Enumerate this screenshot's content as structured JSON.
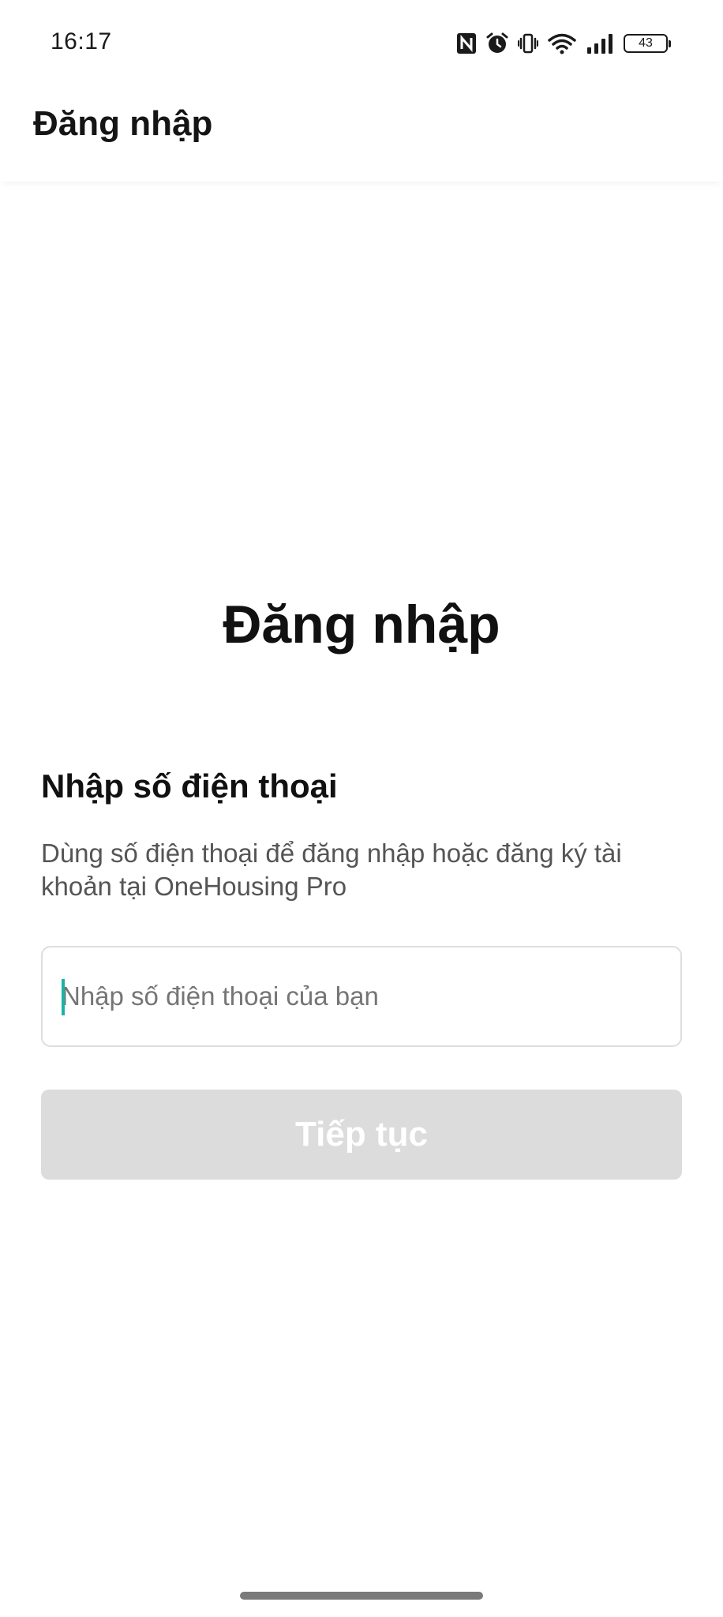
{
  "status_bar": {
    "time": "16:17",
    "battery_level": "43",
    "icons": [
      "nfc-icon",
      "alarm-icon",
      "vibrate-icon",
      "wifi-icon",
      "signal-icon",
      "battery-icon"
    ]
  },
  "app_bar": {
    "title": "Đăng nhập"
  },
  "main": {
    "title": "Đăng nhập",
    "section_heading": "Nhập số điện thoại",
    "description": "Dùng số điện thoại để đăng nhập hoặc đăng ký tài khoản tại OneHousing Pro",
    "phone_input": {
      "value": "",
      "placeholder": "Nhập số điện thoại của bạn"
    },
    "continue_label": "Tiếp tục"
  },
  "colors": {
    "cursor_accent": "#1ab3a6",
    "button_disabled_bg": "#dcdcdc",
    "button_disabled_text": "#ffffff",
    "input_border": "#dedede"
  }
}
